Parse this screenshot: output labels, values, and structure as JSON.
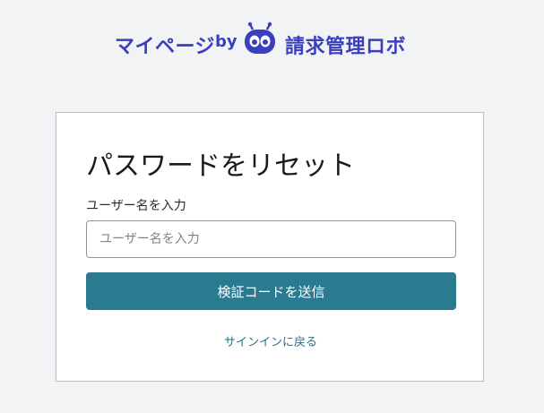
{
  "brand": {
    "prefix": "マイページ",
    "by": "by",
    "name": "請求管理ロボ",
    "color": "#3a3fbf"
  },
  "form": {
    "title": "パスワードをリセット",
    "username_label": "ユーザー名を入力",
    "username_placeholder": "ユーザー名を入力",
    "submit_label": "検証コードを送信",
    "back_link": "サインインに戻る",
    "button_color": "#2a7a90"
  }
}
